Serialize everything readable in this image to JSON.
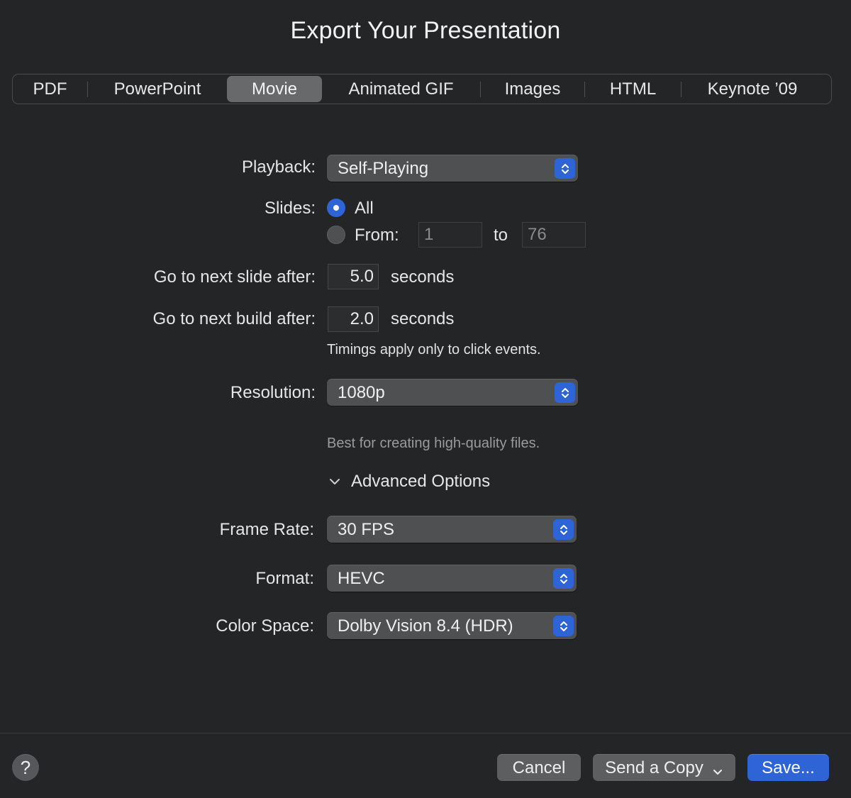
{
  "dialog": {
    "title": "Export Your Presentation"
  },
  "tabs": [
    {
      "label": "PDF",
      "active": false
    },
    {
      "label": "PowerPoint",
      "active": false
    },
    {
      "label": "Movie",
      "active": true
    },
    {
      "label": "Animated GIF",
      "active": false
    },
    {
      "label": "Images",
      "active": false
    },
    {
      "label": "HTML",
      "active": false
    },
    {
      "label": "Keynote ’09",
      "active": false
    }
  ],
  "form": {
    "playback": {
      "label": "Playback:",
      "value": "Self-Playing"
    },
    "slides": {
      "label": "Slides:",
      "all_label": "All",
      "from_label": "From:",
      "from_value": "1",
      "to_label": "to",
      "to_value": "76",
      "selected": "All"
    },
    "next_slide": {
      "label": "Go to next slide after:",
      "value": "5.0",
      "unit": "seconds"
    },
    "next_build": {
      "label": "Go to next build after:",
      "value": "2.0",
      "unit": "seconds"
    },
    "timings_note": "Timings apply only to click events.",
    "resolution": {
      "label": "Resolution:",
      "value": "1080p",
      "hint": "Best for creating high-quality files."
    },
    "advanced": {
      "label": "Advanced Options",
      "expanded": true
    },
    "frame_rate": {
      "label": "Frame Rate:",
      "value": "30 FPS"
    },
    "format": {
      "label": "Format:",
      "value": "HEVC"
    },
    "color_space": {
      "label": "Color Space:",
      "value": "Dolby Vision 8.4 (HDR)"
    }
  },
  "footer": {
    "help_label": "?",
    "cancel_label": "Cancel",
    "send_copy_label": "Send a Copy",
    "save_label": "Save..."
  },
  "colors": {
    "background": "#232527",
    "accent": "#2f64d6",
    "control": "#4e5052",
    "hint_text": "#9a9b9c"
  }
}
